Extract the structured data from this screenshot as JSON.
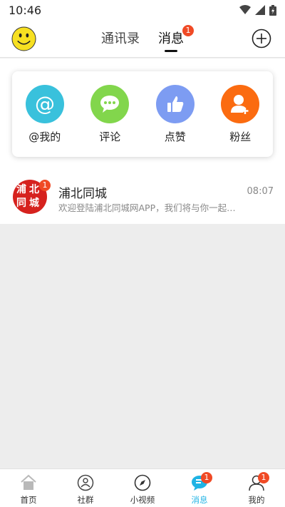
{
  "status": {
    "time": "10:46"
  },
  "header": {
    "tabs": [
      {
        "label": "通讯录",
        "active": false
      },
      {
        "label": "消息",
        "active": true,
        "badge": "1"
      }
    ]
  },
  "quick_actions": [
    {
      "label": "@我的",
      "icon": "at-icon",
      "color": "#39c1dc"
    },
    {
      "label": "评论",
      "icon": "comment-icon",
      "color": "#82d64c"
    },
    {
      "label": "点赞",
      "icon": "thumbs-up-icon",
      "color": "#7d9cf2"
    },
    {
      "label": "粉丝",
      "icon": "fan-user-icon",
      "color": "#fb6b10"
    }
  ],
  "messages": [
    {
      "title": "浦北同城",
      "time": "08:07",
      "preview": "欢迎登陆浦北同城网APP，我们将与你一起…",
      "badge": "1",
      "avatar_text": "浦北同城"
    }
  ],
  "bottom_nav": [
    {
      "label": "首页",
      "icon": "home-icon"
    },
    {
      "label": "社群",
      "icon": "community-icon"
    },
    {
      "label": "小视频",
      "icon": "compass-icon"
    },
    {
      "label": "消息",
      "icon": "message-icon",
      "active": true,
      "badge": "1"
    },
    {
      "label": "我的",
      "icon": "profile-icon",
      "badge": "1"
    }
  ]
}
